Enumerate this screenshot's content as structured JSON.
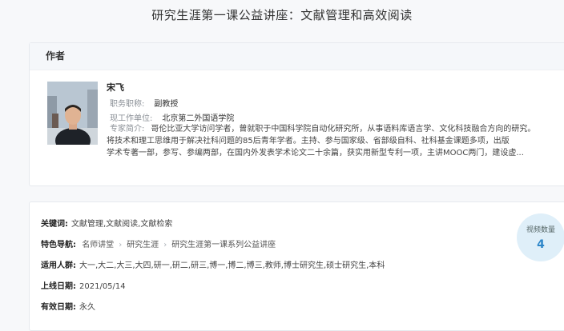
{
  "page": {
    "title": "研究生涯第一课公益讲座：文献管理和高效阅读"
  },
  "author": {
    "section_label": "作者",
    "name": "宋飞",
    "title_label": "职务职称:",
    "title_value": "副教授",
    "unit_label": "现工作单位:",
    "unit_value": "北京第二外国语学院",
    "intro_label": "专家简介:",
    "intro_lines": [
      "哥伦比亚大学访问学者，曾就职于中国科学院自动化研究所，从事语料库语言学、文化科技融合方向的研究。",
      "将技术和理工思维用于解决社科问题的85后青年学者。主持、参与国家级、省部级自科、社科基金课题多项，出版",
      "学术专著一部，参写、参编两部，在国内外发表学术论文二十余篇，获实用新型专利一项，主讲MOOC两门，建设虚..."
    ]
  },
  "info": {
    "keywords_label": "关键词:",
    "keywords_value": "文献管理,文献阅读,文献检索",
    "nav_label": "特色导航:",
    "nav_items": [
      "名师讲堂",
      "研究生涯",
      "研究生涯第一课系列公益讲座"
    ],
    "audience_label": "适用人群:",
    "audience_value": "大一,大二,大三,大四,研一,研二,研三,博一,博二,博三,教师,博士研究生,硕士研究生,本科",
    "date_label": "上线日期:",
    "date_value": "2021/05/14",
    "validity_label": "有效日期:",
    "validity_value": "永久"
  },
  "video_badge": {
    "label": "视频数量",
    "count": "4"
  }
}
